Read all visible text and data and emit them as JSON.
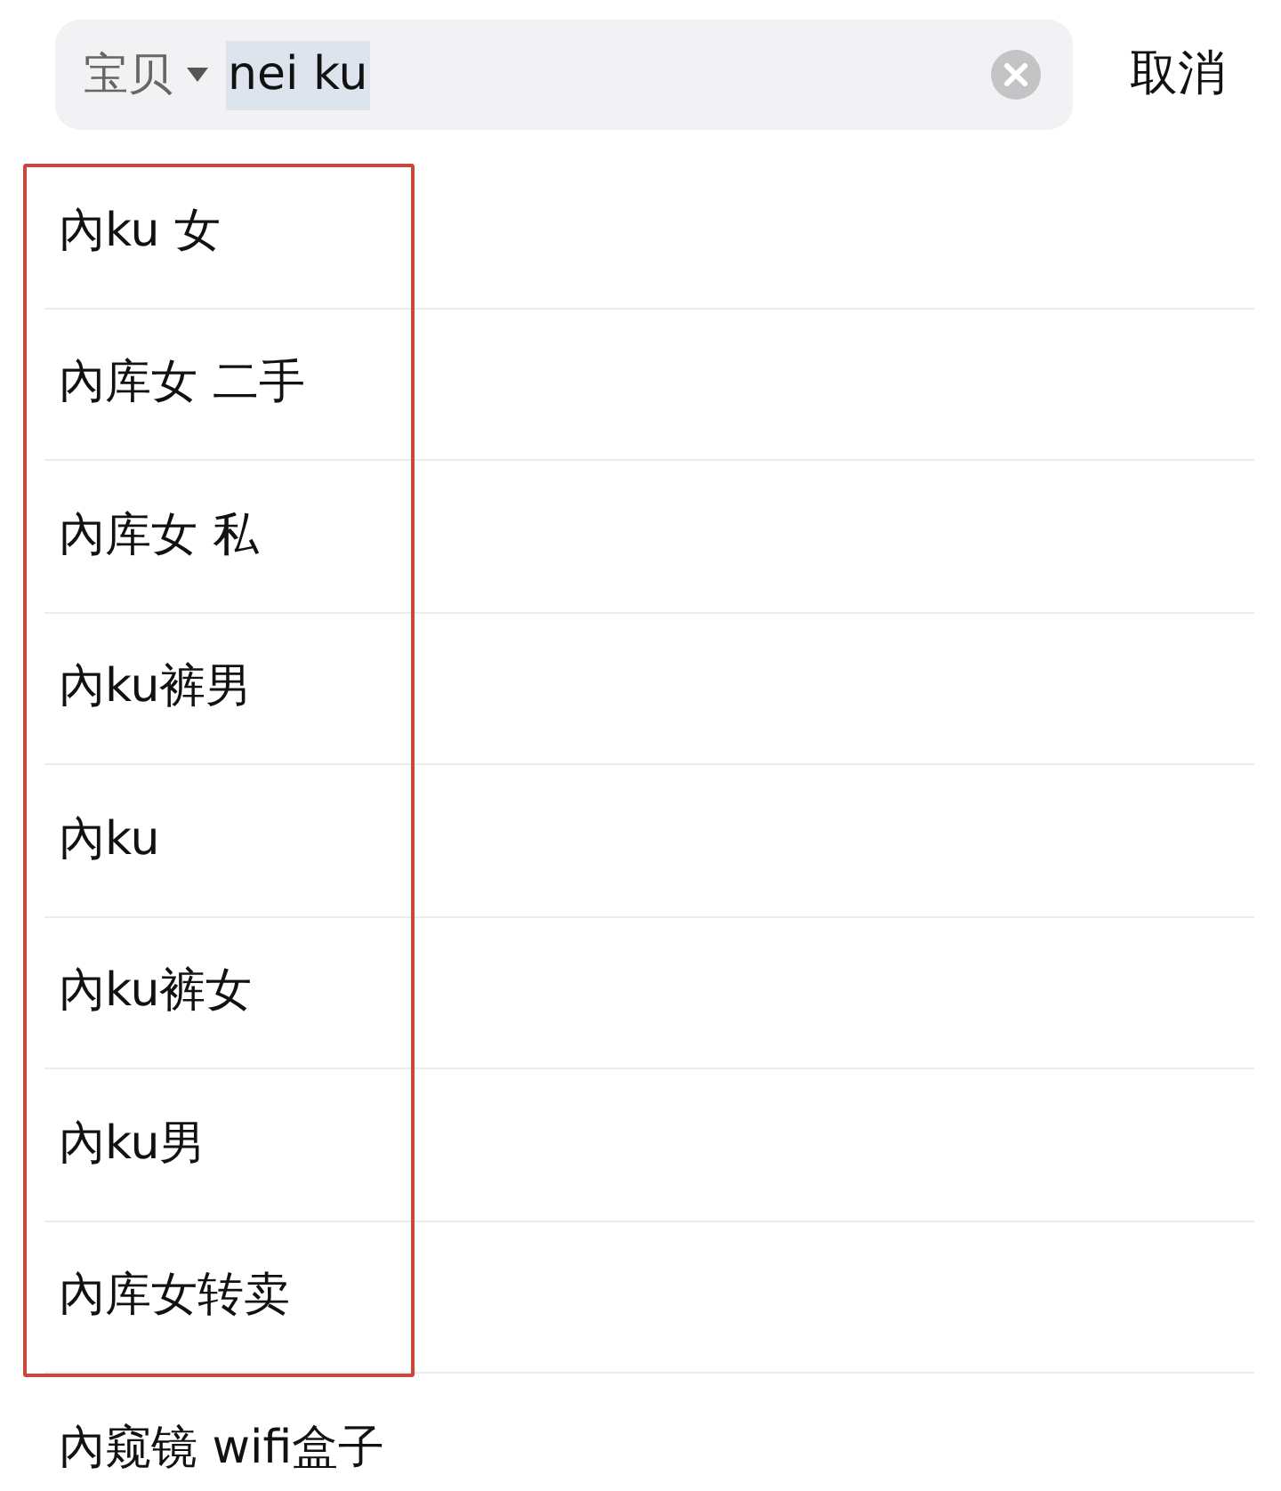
{
  "search_bar": {
    "scope": "宝贝",
    "query": "nei ku",
    "query_selected": true,
    "cancel": "取消"
  },
  "suggestions": [
    {
      "text": "內ku 女",
      "highlighted": true
    },
    {
      "text": "內库女 二手",
      "highlighted": true
    },
    {
      "text": "內库女 私",
      "highlighted": true
    },
    {
      "text": "內ku裤男",
      "highlighted": true
    },
    {
      "text": "內ku",
      "highlighted": true
    },
    {
      "text": "內ku裤女",
      "highlighted": true
    },
    {
      "text": "內ku男",
      "highlighted": true
    },
    {
      "text": "內库女转卖",
      "highlighted": true
    },
    {
      "text": "內窥镜 wifi盒子",
      "highlighted": false
    }
  ]
}
